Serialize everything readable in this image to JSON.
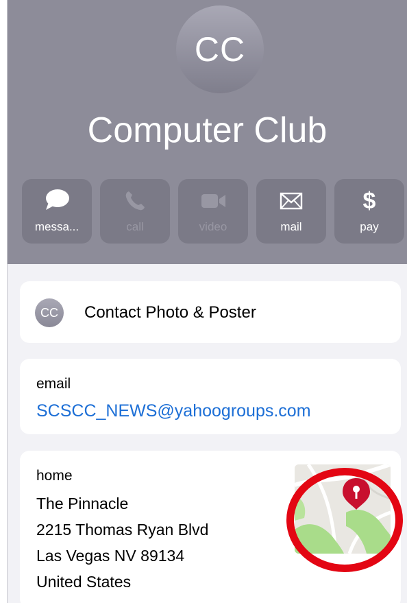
{
  "contact": {
    "initials": "CC",
    "name": "Computer Club"
  },
  "actions": [
    {
      "label": "messa...",
      "icon": "message-bubble-icon",
      "enabled": true
    },
    {
      "label": "call",
      "icon": "phone-icon",
      "enabled": false
    },
    {
      "label": "video",
      "icon": "video-camera-icon",
      "enabled": false
    },
    {
      "label": "mail",
      "icon": "envelope-icon",
      "enabled": true
    },
    {
      "label": "pay",
      "icon": "dollar-icon",
      "enabled": true
    }
  ],
  "photo_poster": {
    "initials": "CC",
    "label": "Contact Photo & Poster"
  },
  "email": {
    "label": "email",
    "value": "SCSCC_NEWS@yahoogroups.com"
  },
  "address": {
    "label": "home",
    "lines": [
      "The Pinnacle",
      "2215 Thomas Ryan Blvd",
      "Las Vegas NV 89134",
      "United States"
    ]
  },
  "colors": {
    "header_bg": "#8d8c99",
    "link_blue": "#1d6fd6",
    "annotation_red": "#e30613",
    "pin_red": "#c8102e"
  }
}
